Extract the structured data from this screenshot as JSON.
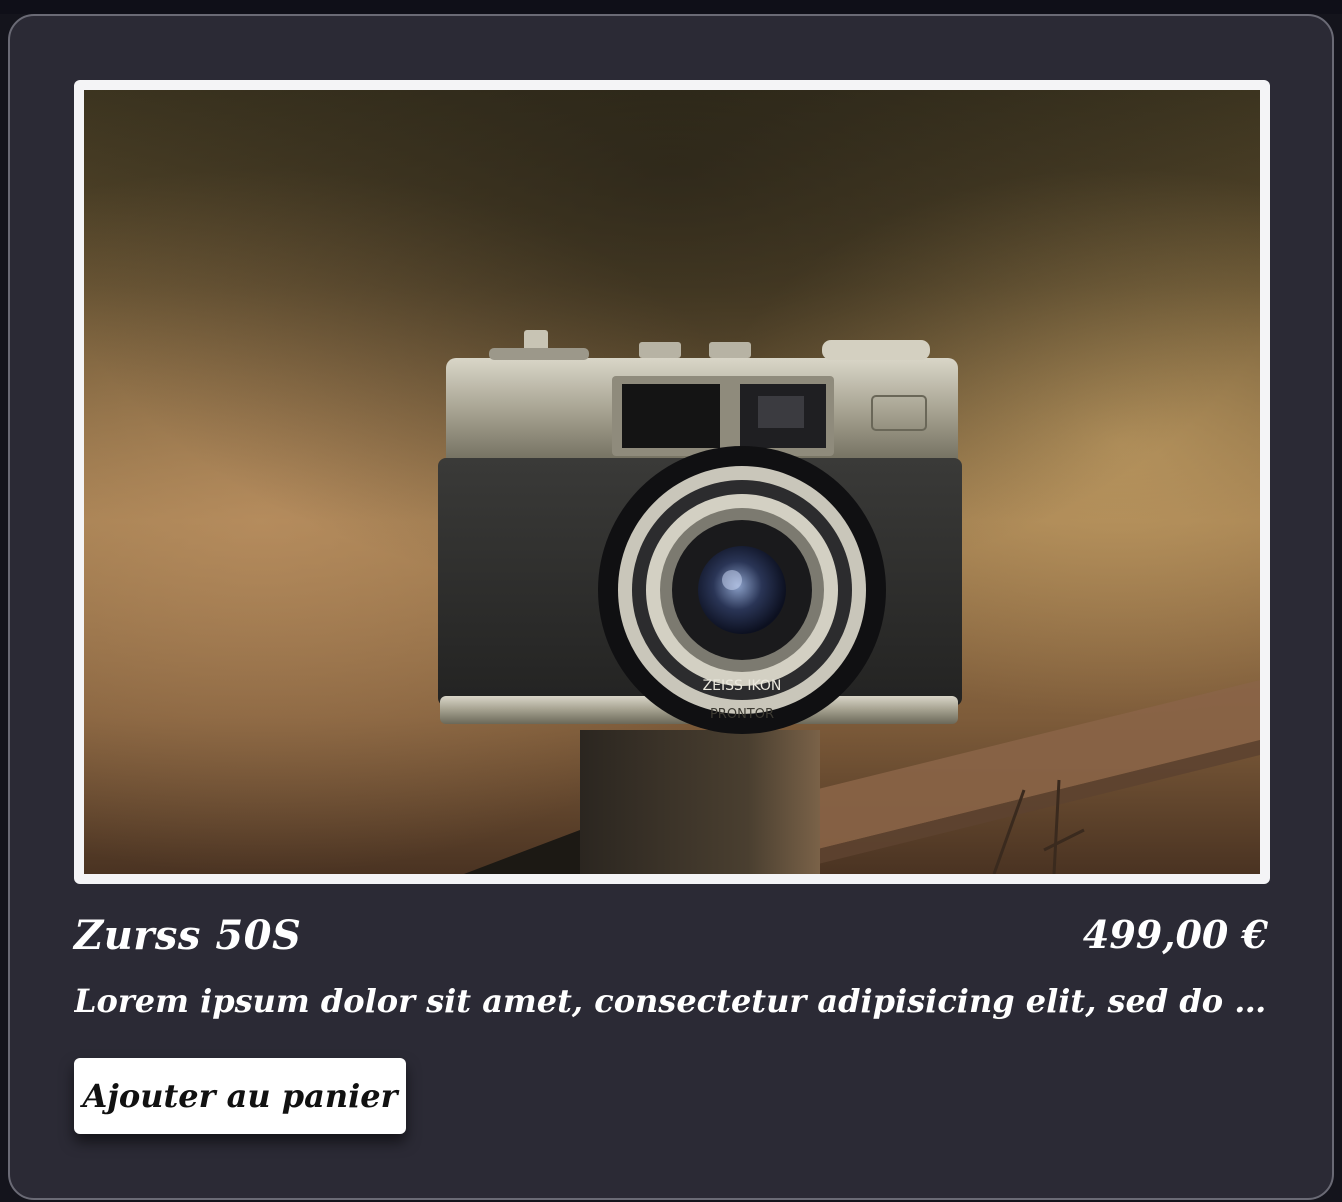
{
  "product": {
    "name": "Zurss 50S",
    "price": "499,00 €",
    "description": "Lorem ipsum dolor sit amet, consectetur adipisicing elit, sed do eiusmod tempor incididunt ut labore et dolore magna aliqua.",
    "image_subject": "vintage rangefinder camera on a fence post",
    "lens_text": "ZEISS IKON",
    "shutter_text": "PRONTOR"
  },
  "actions": {
    "add_to_cart_label": "Ajouter au panier"
  },
  "colors": {
    "card_background": "#2b2a35",
    "page_background": "#14141c",
    "button_background": "#ffffff",
    "text": "#ffffff"
  }
}
